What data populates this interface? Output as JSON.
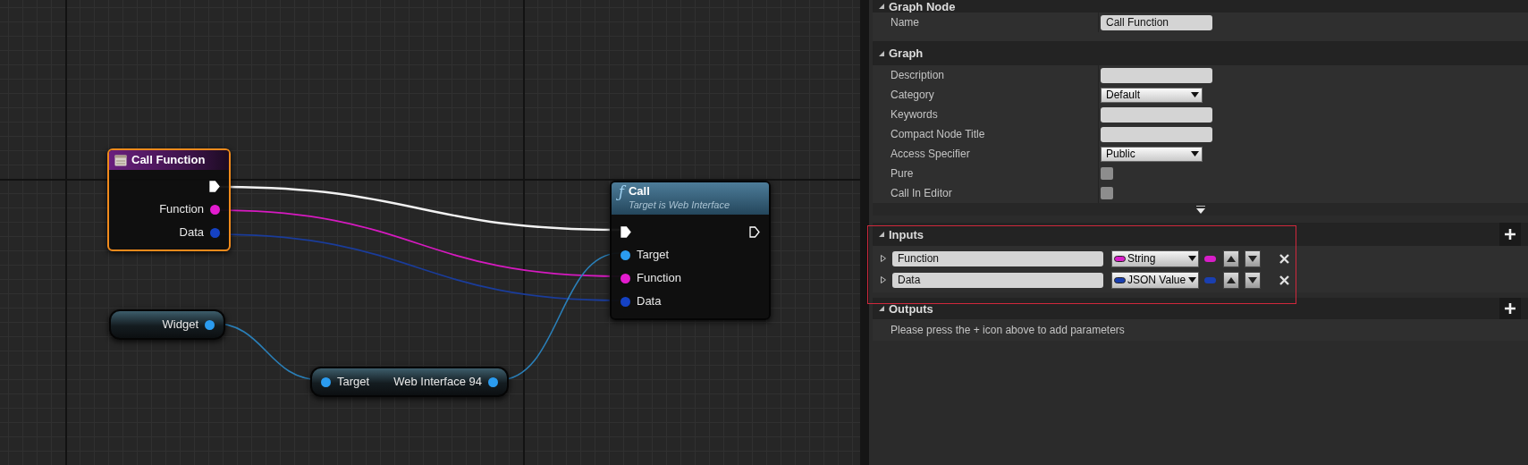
{
  "graph": {
    "nodes": [
      {
        "kind": "entry",
        "title": "Call Function",
        "selected": true,
        "outputs": [
          {
            "kind": "exec",
            "connected": true
          },
          {
            "kind": "data",
            "label": "Function",
            "color": "#e31ccf",
            "connected": true
          },
          {
            "kind": "data",
            "label": "Data",
            "color": "#1542c4",
            "connected": true
          }
        ]
      },
      {
        "kind": "call",
        "icon": "ƒ",
        "title": "Call",
        "subtitle": "Target is Web Interface",
        "selected": false,
        "inputs": [
          {
            "kind": "exec",
            "connected": true
          },
          {
            "kind": "data",
            "label": "Target",
            "color": "#2b9cf0",
            "connected": true
          },
          {
            "kind": "data",
            "label": "Function",
            "color": "#e31ccf",
            "connected": true
          },
          {
            "kind": "data",
            "label": "Data",
            "color": "#1542c4",
            "connected": true
          }
        ],
        "outputs": [
          {
            "kind": "exec",
            "connected": false
          }
        ]
      },
      {
        "kind": "variable",
        "selected": false,
        "outputs": [
          {
            "kind": "data",
            "label": "Widget",
            "color": "#2b9cf0",
            "connected": true
          }
        ]
      },
      {
        "kind": "compact",
        "selected": false,
        "inputs": [
          {
            "kind": "data",
            "label": "Target",
            "color": "#2b9cf0",
            "connected": true
          }
        ],
        "outputs": [
          {
            "kind": "data",
            "label": "Web Interface 94",
            "color": "#2b9cf0",
            "connected": true
          }
        ]
      }
    ]
  },
  "details": {
    "sections": [
      {
        "title": "Graph Node",
        "expanded": true,
        "rows": [
          {
            "kind": "text",
            "label": "Name",
            "value": "Call Function"
          }
        ]
      },
      {
        "title": "Graph",
        "expanded": true,
        "advanced_collapsed": true,
        "rows": [
          {
            "kind": "text",
            "label": "Description"
          },
          {
            "kind": "dropdown",
            "label": "Category",
            "value": "Default"
          },
          {
            "kind": "text",
            "label": "Keywords"
          },
          {
            "kind": "text",
            "label": "Compact Node Title"
          },
          {
            "kind": "dropdown",
            "label": "Access Specifier",
            "value": "Public"
          },
          {
            "kind": "checkbox",
            "label": "Pure",
            "checked": false
          },
          {
            "kind": "checkbox",
            "label": "Call In Editor",
            "checked": false
          }
        ]
      }
    ],
    "inputs": {
      "title": "Inputs",
      "expanded": true,
      "params": [
        {
          "name": "Function",
          "type": "String",
          "color": "#d81ec8",
          "expanded": false
        },
        {
          "name": "Data",
          "type": "JSON Value",
          "color": "#1a3fb0",
          "expanded": false
        }
      ]
    },
    "outputs": {
      "title": "Outputs",
      "expanded": true,
      "message": "Please press the + icon above to add parameters"
    }
  }
}
